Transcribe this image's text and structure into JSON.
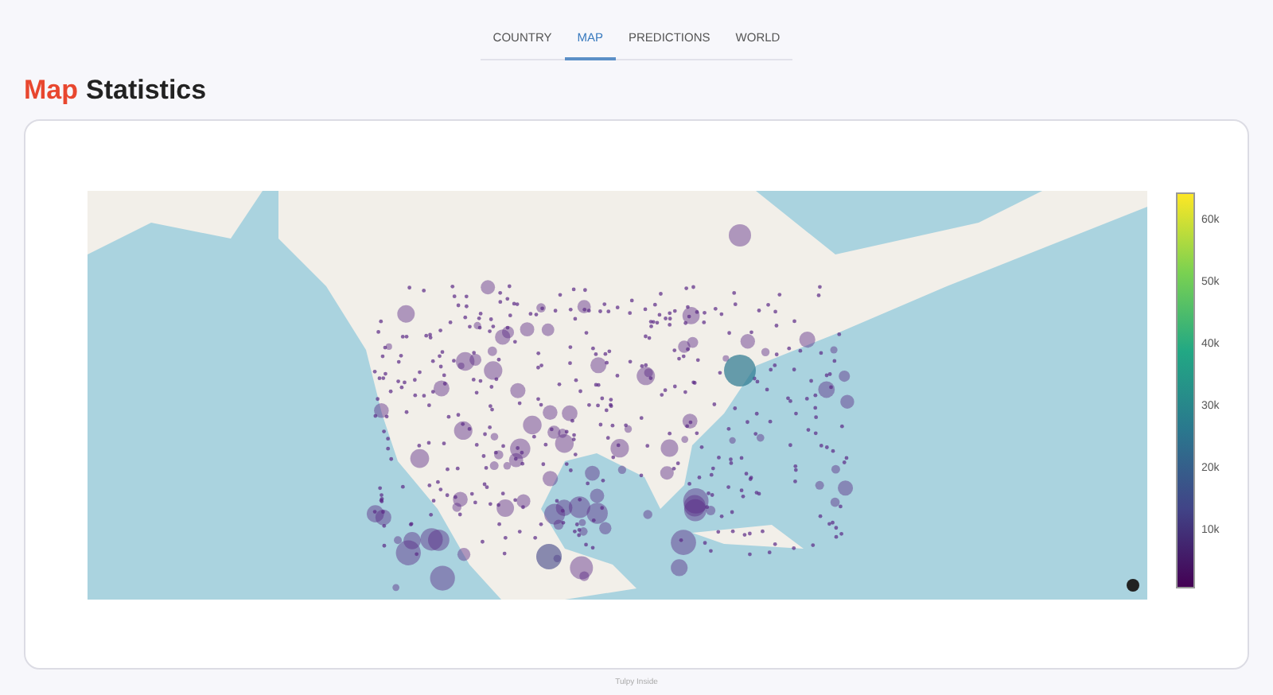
{
  "tabs": [
    {
      "label": "COUNTRY",
      "selected": false
    },
    {
      "label": "MAP",
      "selected": true
    },
    {
      "label": "PREDICTIONS",
      "selected": false
    },
    {
      "label": "WORLD",
      "selected": false
    }
  ],
  "heading": {
    "accent": "Map",
    "rest": "Statistics"
  },
  "colorbar": {
    "ticks": [
      "60k",
      "50k",
      "40k",
      "30k",
      "20k",
      "10k"
    ]
  },
  "footer": "Tulpy Inside"
}
